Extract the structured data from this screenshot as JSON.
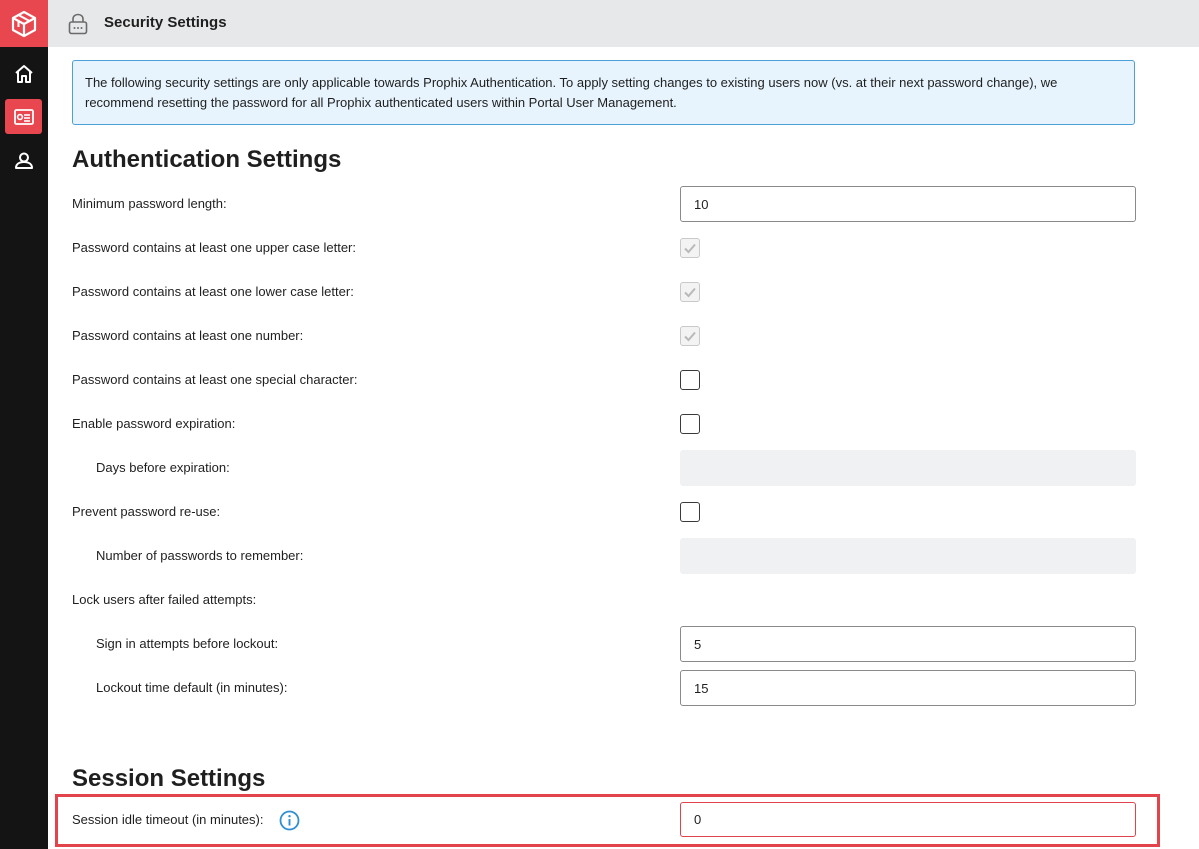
{
  "header": {
    "title": "Security Settings"
  },
  "sidebar": {
    "items": [
      {
        "icon": "home-icon"
      },
      {
        "icon": "security-settings-icon",
        "active": true
      },
      {
        "icon": "users-icon"
      }
    ]
  },
  "banner": {
    "text": "The following security settings are only applicable towards Prophix Authentication. To apply setting changes to existing users now (vs. at their next password change), we recommend resetting the password for all Prophix authenticated users within Portal User Management."
  },
  "authentication": {
    "title": "Authentication Settings",
    "min_length_label": "Minimum password length:",
    "min_length_value": "10",
    "upper_label": "Password contains at least one upper case letter:",
    "upper_checked": true,
    "lower_label": "Password contains at least one lower case letter:",
    "lower_checked": true,
    "number_label": "Password contains at least one number:",
    "number_checked": true,
    "special_label": "Password contains at least one special character:",
    "special_checked": false,
    "expiration_label": "Enable password expiration:",
    "expiration_checked": false,
    "days_label": "Days before expiration:",
    "days_value": "",
    "reuse_label": "Prevent password re-use:",
    "reuse_checked": false,
    "remember_label": "Number of passwords to remember:",
    "remember_value": "",
    "lock_label": "Lock users after failed attempts:",
    "attempts_label": "Sign in attempts before lockout:",
    "attempts_value": "5",
    "lockout_time_label": "Lockout time default (in minutes):",
    "lockout_time_value": "15"
  },
  "session": {
    "title": "Session Settings",
    "timeout_label": "Session idle timeout (in minutes):",
    "timeout_value": "0"
  },
  "colors": {
    "accent": "#e8474f",
    "rail": "#141414",
    "banner_bg": "#e7f4fd",
    "banner_border": "#4ba0d8",
    "info_icon": "#2f8fd0"
  }
}
